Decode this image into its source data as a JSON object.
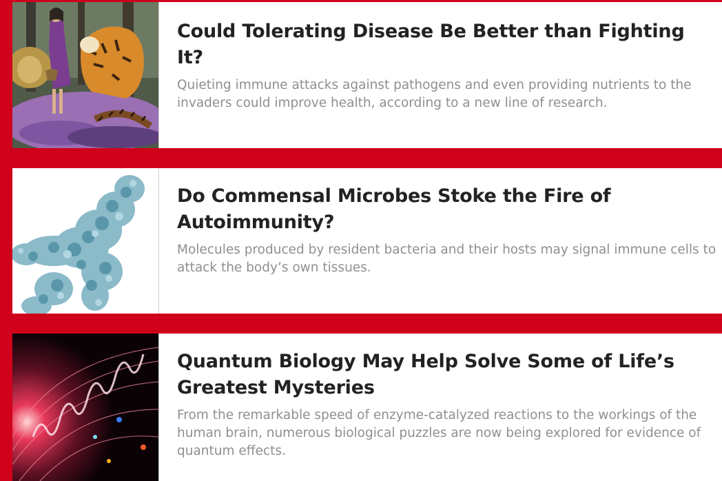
{
  "articles": [
    {
      "title": "Could Tolerating Disease Be Better than Fighting It?",
      "description": "Quieting immune attacks against pathogens and even providing nutrients to the invaders could improve health, according to a new line of research.",
      "image": "woman-and-tiger-illustration"
    },
    {
      "title": "Do Commensal Microbes Stoke the Fire of Autoimmunity?",
      "description": "Molecules produced by resident bacteria and their hosts may signal immune cells to attack the body’s own tissues.",
      "image": "molecular-protein-structure-illustration"
    },
    {
      "title": "Quantum Biology May Help Solve Some of Life’s Greatest Mysteries",
      "description": "From the remarkable speed of enzyme-catalyzed reactions to the workings of the human brain, numerous biological puzzles are now being explored for evidence of quantum effects.",
      "image": "quantum-wave-illustration"
    }
  ],
  "colors": {
    "background": "#d0021b",
    "card": "#ffffff",
    "title": "#222222",
    "description": "#8f8f8f"
  }
}
